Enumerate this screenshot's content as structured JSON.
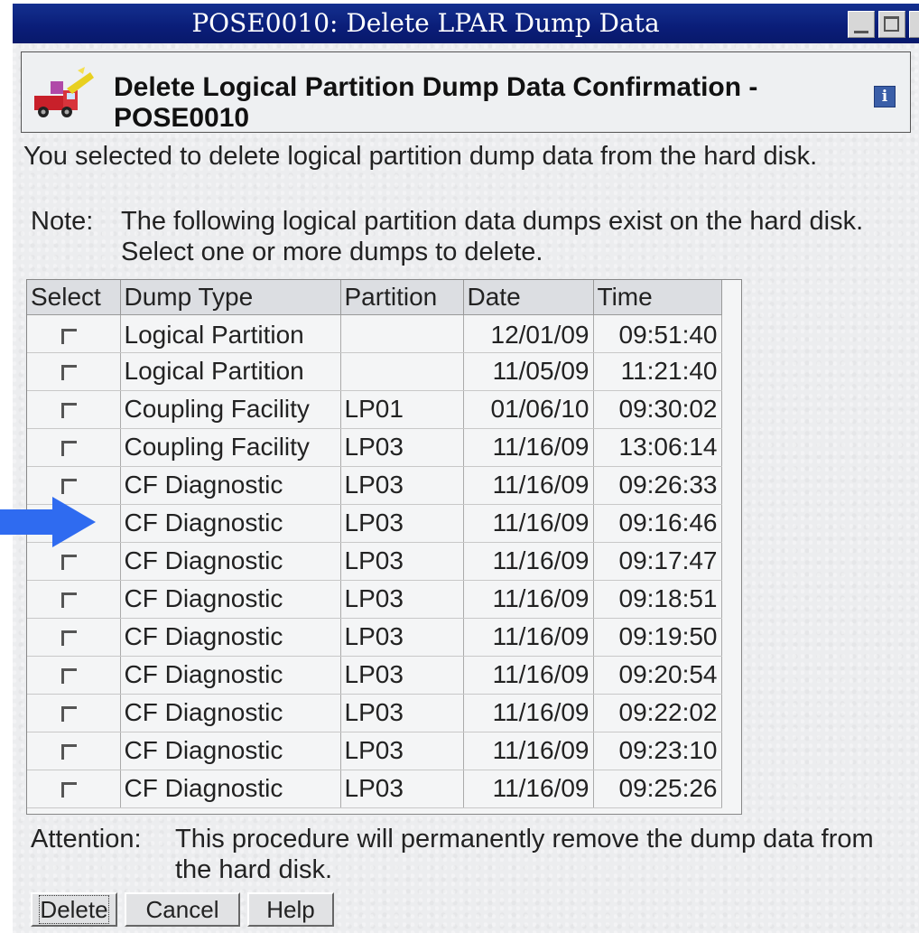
{
  "window": {
    "title": "POSE0010: Delete LPAR Dump Data"
  },
  "header": {
    "title": "Delete Logical Partition Dump Data Confirmation - POSE0010",
    "icon": "delete-truck-icon",
    "info_icon": "info-icon",
    "info_label": "i"
  },
  "intro": "You selected to delete logical partition dump data from the hard disk.",
  "note": {
    "label": "Note:",
    "text": "The following logical partition data dumps exist on the hard disk. Select one or more dumps to delete."
  },
  "table": {
    "columns": [
      "Select",
      "Dump Type",
      "Partition",
      "Date",
      "Time"
    ],
    "rows": [
      {
        "type": "Logical Partition",
        "partition": "",
        "date": "12/01/09",
        "time": "09:51:40",
        "checked": false
      },
      {
        "type": "Logical Partition",
        "partition": "",
        "date": "11/05/09",
        "time": "11:21:40",
        "checked": false
      },
      {
        "type": "Coupling Facility",
        "partition": "LP01",
        "date": "01/06/10",
        "time": "09:30:02",
        "checked": false
      },
      {
        "type": "Coupling Facility",
        "partition": "LP03",
        "date": "11/16/09",
        "time": "13:06:14",
        "checked": false
      },
      {
        "type": "CF Diagnostic",
        "partition": "LP03",
        "date": "11/16/09",
        "time": "09:26:33",
        "checked": false
      },
      {
        "type": "CF Diagnostic",
        "partition": "LP03",
        "date": "11/16/09",
        "time": "09:16:46",
        "checked": false
      },
      {
        "type": "CF Diagnostic",
        "partition": "LP03",
        "date": "11/16/09",
        "time": "09:17:47",
        "checked": false
      },
      {
        "type": "CF Diagnostic",
        "partition": "LP03",
        "date": "11/16/09",
        "time": "09:18:51",
        "checked": false
      },
      {
        "type": "CF Diagnostic",
        "partition": "LP03",
        "date": "11/16/09",
        "time": "09:19:50",
        "checked": false
      },
      {
        "type": "CF Diagnostic",
        "partition": "LP03",
        "date": "11/16/09",
        "time": "09:20:54",
        "checked": false
      },
      {
        "type": "CF Diagnostic",
        "partition": "LP03",
        "date": "11/16/09",
        "time": "09:22:02",
        "checked": false
      },
      {
        "type": "CF Diagnostic",
        "partition": "LP03",
        "date": "11/16/09",
        "time": "09:23:10",
        "checked": false
      },
      {
        "type": "CF Diagnostic",
        "partition": "LP03",
        "date": "11/16/09",
        "time": "09:25:26",
        "checked": false
      }
    ]
  },
  "attention": {
    "label": "Attention:",
    "text": "This procedure will permanently remove the dump data from the hard disk."
  },
  "buttons": {
    "delete": "Delete",
    "cancel": "Cancel",
    "help": "Help"
  },
  "annotation": {
    "icon": "arrow-right-icon",
    "color": "#2f6bf0",
    "points_to_row": 6
  },
  "colors": {
    "titlebar": "#0a1d78",
    "dialog_bg": "#ecedef"
  }
}
